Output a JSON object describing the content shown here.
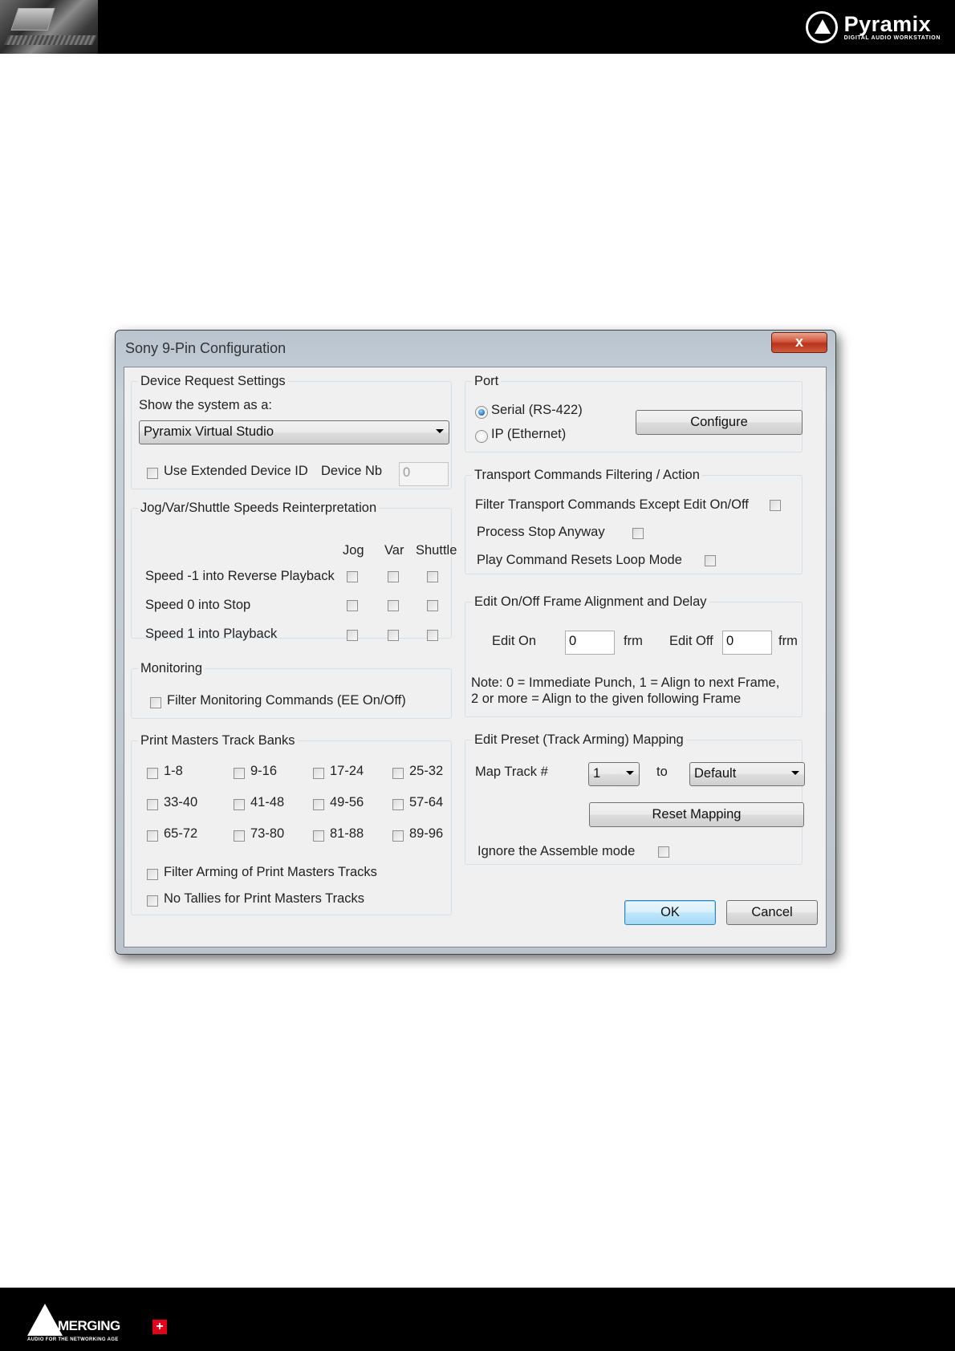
{
  "header": {
    "brand_name": "Pyramix",
    "brand_subtitle": "DIGITAL AUDIO WORKSTATION"
  },
  "footer": {
    "brand_name": "MERGING",
    "brand_plus": "+",
    "brand_subtitle": "AUDIO FOR THE NETWORKING AGE"
  },
  "dialog": {
    "title": "Sony 9-Pin Configuration",
    "close_label": "x",
    "device_request": {
      "legend": "Device Request Settings",
      "show_as_label": "Show the system as a:",
      "show_as_value": "Pyramix Virtual Studio",
      "use_extended_label": "Use Extended Device ID",
      "device_nb_label": "Device Nb",
      "device_nb_value": "0"
    },
    "jog": {
      "legend": "Jog/Var/Shuttle Speeds Reinterpretation",
      "columns": [
        "Jog",
        "Var",
        "Shuttle"
      ],
      "rows": [
        "Speed -1 into Reverse Playback",
        "Speed 0 into Stop",
        "Speed 1 into Playback"
      ]
    },
    "monitoring": {
      "legend": "Monitoring",
      "filter_label": "Filter Monitoring Commands (EE On/Off)"
    },
    "print_masters": {
      "legend": "Print Masters Track Banks",
      "banks": [
        "1-8",
        "9-16",
        "17-24",
        "25-32",
        "33-40",
        "41-48",
        "49-56",
        "57-64",
        "65-72",
        "73-80",
        "81-88",
        "89-96"
      ],
      "filter_arming_label": "Filter Arming of Print Masters Tracks",
      "no_tallies_label": "No Tallies for Print Masters Tracks"
    },
    "port": {
      "legend": "Port",
      "serial_label": "Serial (RS-422)",
      "ip_label": "IP (Ethernet)",
      "selected": "serial",
      "configure_label": "Configure"
    },
    "transport": {
      "legend": "Transport Commands Filtering / Action",
      "filter_label": "Filter Transport Commands Except Edit On/Off",
      "process_stop_label": "Process Stop Anyway",
      "play_resets_label": "Play Command Resets Loop Mode"
    },
    "edit_frame": {
      "legend": "Edit On/Off Frame Alignment and Delay",
      "edit_on_label": "Edit On",
      "edit_on_value": "0",
      "edit_off_label": "Edit Off",
      "edit_off_value": "0",
      "unit": "frm",
      "note_line1": "Note: 0 = Immediate Punch, 1 = Align to next Frame,",
      "note_line2": "2 or more = Align to the given following Frame"
    },
    "edit_preset": {
      "legend": "Edit Preset (Track Arming) Mapping",
      "map_track_label": "Map Track #",
      "map_track_value": "1",
      "to_label": "to",
      "to_value": "Default",
      "reset_label": "Reset Mapping",
      "ignore_assemble_label": "Ignore the Assemble mode"
    },
    "ok_label": "OK",
    "cancel_label": "Cancel"
  }
}
